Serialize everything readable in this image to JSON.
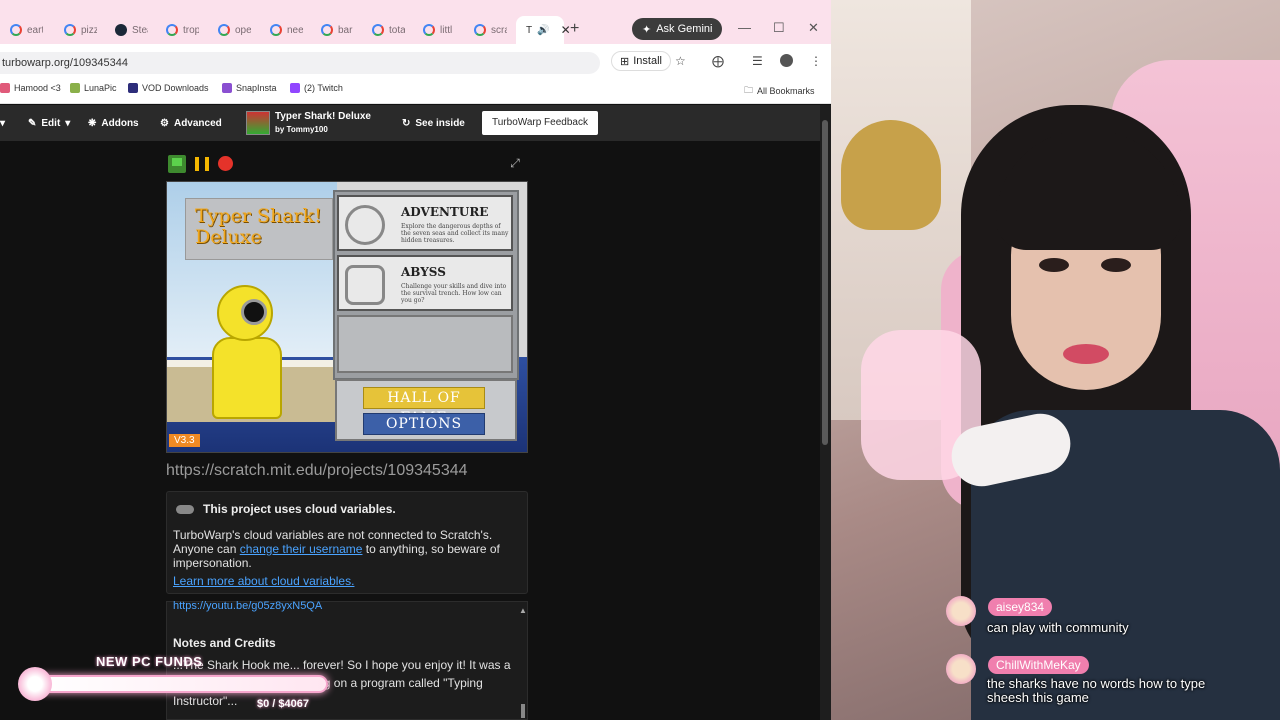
{
  "browser": {
    "tabs": [
      {
        "label": "eart",
        "icon": "google-icon"
      },
      {
        "label": "pizz",
        "icon": "google-icon"
      },
      {
        "label": "Stea",
        "icon": "steam-icon"
      },
      {
        "label": "trop",
        "icon": "google-icon"
      },
      {
        "label": "ope",
        "icon": "google-icon"
      },
      {
        "label": "nee",
        "icon": "google-icon"
      },
      {
        "label": "bar",
        "icon": "google-icon"
      },
      {
        "label": "tota",
        "icon": "google-icon"
      },
      {
        "label": "littl",
        "icon": "google-icon"
      },
      {
        "label": "scra",
        "icon": "google-icon"
      },
      {
        "label": "T",
        "icon": "turbowarp-icon",
        "active": true
      }
    ],
    "new_tab_label": "+",
    "gemini_label": "Ask Gemini",
    "url": "turbowarp.org/109345344",
    "install_label": "Install",
    "bookmarks": [
      {
        "label": "Hamood <3",
        "color": "#e05a7a"
      },
      {
        "label": "LunaPic",
        "color": "#8ab04a"
      },
      {
        "label": "VOD Downloads",
        "color": "#2d2d7a"
      },
      {
        "label": "SnapInsta",
        "color": "#8a4fd1"
      },
      {
        "label": "(2) Twitch",
        "color": "#9146ff"
      }
    ],
    "all_bookmarks_label": "All Bookmarks"
  },
  "turbowarp": {
    "menu": {
      "edit_label": "Edit",
      "addons_label": "Addons",
      "advanced_label": "Advanced",
      "project_title": "Typer Shark! Deluxe",
      "project_author": "by Tommy100",
      "see_inside_label": "See inside",
      "feedback_label": "TurboWarp Feedback"
    },
    "stage": {
      "game_title": "Typer Shark! Deluxe",
      "adventure_title": "ADVENTURE",
      "adventure_desc": "Explore the dangerous depths of the seven seas and collect its many hidden treasures.",
      "abyss_title": "ABYSS",
      "abyss_desc": "Challenge your skills and dive into the survival trench. How low can you go?",
      "hall_of_fame_label": "HALL OF FAME",
      "options_label": "OPTIONS",
      "version": "V3.3"
    },
    "project_url": "https://scratch.mit.edu/projects/109345344",
    "cloud": {
      "title": "This project uses cloud variables.",
      "body_prefix": "TurboWarp's cloud variables are not connected to Scratch's. Anyone can ",
      "body_link": "change their username",
      "body_suffix": " to anything, so beware of impersonation.",
      "learn_more": "Learn more about cloud variables."
    },
    "notes": {
      "cut_link": "https://youtu.be/g05z8yxN5QA",
      "title": "Notes and Credits",
      "body": "...The Shark Hook me... forever! So I hope you enjoy it! It was a game I wanted to learn typing on a program called \"Typing Instructor\"..."
    }
  },
  "overlay": {
    "funds_label": "NEW PC FUNDS",
    "funds_amount": "$0 / $4067",
    "funds_progress": 0
  },
  "chat": [
    {
      "user": "aisey834",
      "message": "can play with community"
    },
    {
      "user": "ChillWithMeKay",
      "message": "the sharks have no words how to type sheesh this game"
    }
  ],
  "colors": {
    "tabstrip": "#fbe1ec",
    "turbowarp_bar": "#2a2a2a",
    "link": "#4aa3ff",
    "chat_name_bg": "#f07fae",
    "hof": "#e6c339",
    "options": "#3c60a8"
  }
}
